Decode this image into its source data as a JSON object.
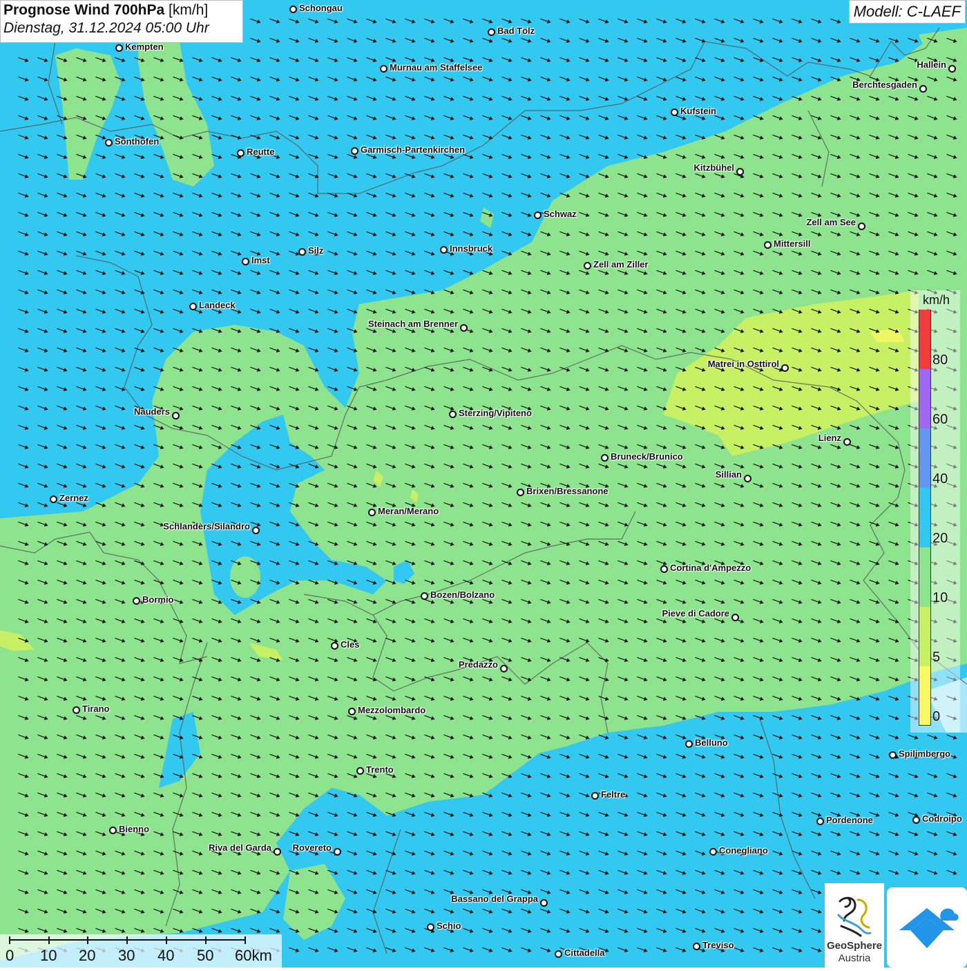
{
  "title": {
    "main": "Prognose Wind 700hPa",
    "unit": "[km/h]",
    "datetime": "Dienstag, 31.12.2024 05:00 Uhr"
  },
  "model": "Modell: C-LAEF",
  "legend": {
    "unit": "km/h",
    "labels": [
      "80",
      "60",
      "40",
      "20",
      "10",
      "5",
      "0"
    ],
    "colors": {
      "c80": "#f03c3c",
      "c60": "#a068f0",
      "c40": "#6498f0",
      "c20": "#32c8f0",
      "c10": "#8ee38f",
      "c5": "#c8f064",
      "c0": "#f8f864",
      "c_low": "#a8e8f8"
    }
  },
  "scale": {
    "labels": [
      "0",
      "10",
      "20",
      "30",
      "40",
      "50",
      "60km"
    ]
  },
  "logos": {
    "geosphere_line1": "GeoSphere",
    "geosphere_line2": "Austria"
  },
  "icons": {
    "app_logo": "mountain-app-icon",
    "geosphere_logo": "geosphere-swirl-icon"
  },
  "wind": {
    "direction_deg": 20,
    "background_speed_kmh": 15
  },
  "cities": [
    {
      "name": "Schongau",
      "side": "right"
    },
    {
      "name": "Bad Tölz",
      "side": "right"
    },
    {
      "name": "Kempten",
      "side": "right"
    },
    {
      "name": "Murnau am Staffelsee",
      "side": "right"
    },
    {
      "name": "Hallein",
      "side": "left"
    },
    {
      "name": "Berchtesgaden",
      "side": "left"
    },
    {
      "name": "Kufstein",
      "side": "right"
    },
    {
      "name": "Sonthofen",
      "side": "right"
    },
    {
      "name": "Reutte",
      "side": "right"
    },
    {
      "name": "Garmisch-Partenkirchen",
      "side": "right"
    },
    {
      "name": "Kitzbühel",
      "side": "left"
    },
    {
      "name": "Schwaz",
      "side": "right"
    },
    {
      "name": "Zell am See",
      "side": "left"
    },
    {
      "name": "Innsbruck",
      "side": "right"
    },
    {
      "name": "Mittersill",
      "side": "right"
    },
    {
      "name": "Silz",
      "side": "right"
    },
    {
      "name": "Imst",
      "side": "right"
    },
    {
      "name": "Zell am Ziller",
      "side": "right"
    },
    {
      "name": "Landeck",
      "side": "right"
    },
    {
      "name": "Steinach am Brenner",
      "side": "left"
    },
    {
      "name": "Matrei in Osttirol",
      "side": "left"
    },
    {
      "name": "Nauders",
      "side": "left"
    },
    {
      "name": "Sterzing/Vipiteno",
      "side": "right"
    },
    {
      "name": "Lienz",
      "side": "left"
    },
    {
      "name": "Bruneck/Brunico",
      "side": "right"
    },
    {
      "name": "Sillian",
      "side": "left"
    },
    {
      "name": "Brixen/Bressanone",
      "side": "right"
    },
    {
      "name": "Zernez",
      "side": "right"
    },
    {
      "name": "Meran/Merano",
      "side": "right"
    },
    {
      "name": "Schlanders/Silandro",
      "side": "left"
    },
    {
      "name": "Cortina d'Ampezzo",
      "side": "right"
    },
    {
      "name": "Bozen/Bolzano",
      "side": "right"
    },
    {
      "name": "Bormio",
      "side": "right"
    },
    {
      "name": "Pieve di Cadore",
      "side": "left"
    },
    {
      "name": "Cles",
      "side": "right"
    },
    {
      "name": "Predazzo",
      "side": "left"
    },
    {
      "name": "Tirano",
      "side": "right"
    },
    {
      "name": "Mezzolombardo",
      "side": "right"
    },
    {
      "name": "Belluno",
      "side": "right"
    },
    {
      "name": "Spilimbergo",
      "side": "right"
    },
    {
      "name": "Trento",
      "side": "right"
    },
    {
      "name": "Feltre",
      "side": "right"
    },
    {
      "name": "Pordenone",
      "side": "right"
    },
    {
      "name": "Codroipo",
      "side": "right"
    },
    {
      "name": "Bienno",
      "side": "right"
    },
    {
      "name": "Riva del Garda",
      "side": "left"
    },
    {
      "name": "Rovereto",
      "side": "left"
    },
    {
      "name": "Conegliano",
      "side": "right"
    },
    {
      "name": "Bassano del Grappa",
      "side": "left"
    },
    {
      "name": "Schio",
      "side": "right"
    },
    {
      "name": "Treviso",
      "side": "right"
    },
    {
      "name": "Cittadella",
      "side": "right"
    }
  ]
}
